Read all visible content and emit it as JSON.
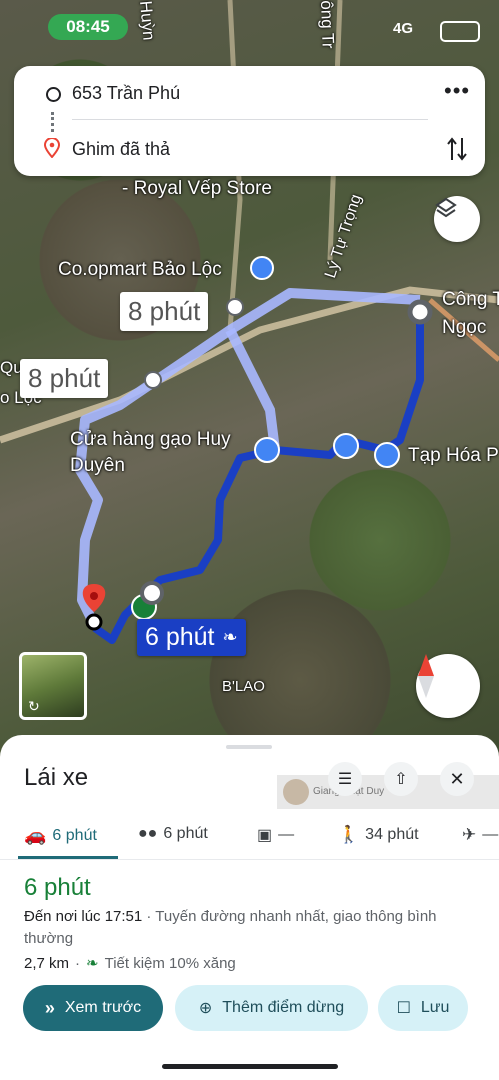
{
  "status": {
    "time": "08:45",
    "signal": "4G"
  },
  "search": {
    "origin": "653 Trần Phú",
    "destination": "Ghim đã thả"
  },
  "map": {
    "labels": {
      "royal": "- Royal Vếp Store",
      "coop": "Co.opmart Bảo Lộc",
      "ly_tu_trong": "Lý Tự Trọng",
      "cong": "Công T",
      "ngoc": "Ngọc",
      "quan": "Quán",
      "bao_loc": "o Lộc",
      "gao1": "Cửa hàng gạo Huy",
      "gao2": "Duyên",
      "tap_hoa": "Tạp Hóa P",
      "blao": "B'LAO",
      "huynh": "Huỳn",
      "dong": "ông Tr"
    },
    "alt_time_1": "8 phút",
    "alt_time_2": "8 phút",
    "main_time": "6 phút"
  },
  "sheet": {
    "title": "Lái xe",
    "watermark": "Giang Nhật Duy",
    "modes": [
      {
        "icon": "car-icon",
        "label": "6 phút",
        "active": true
      },
      {
        "icon": "motorbike-icon",
        "label": "6 phút"
      },
      {
        "icon": "transit-icon",
        "label": "—"
      },
      {
        "icon": "walk-icon",
        "label": "34 phút"
      },
      {
        "icon": "flight-icon",
        "label": "—"
      }
    ],
    "duration": "6 phút",
    "arrival": "Đến nơi lúc 17:51",
    "route_desc": " · Tuyến đường nhanh nhất, giao thông bình thường",
    "distance": "2,7 km",
    "fuel": "Tiết kiệm 10% xăng",
    "buttons": {
      "preview": "Xem trước",
      "add_stop": "Thêm điểm dừng",
      "save": "Lưu"
    }
  },
  "colors": {
    "accent": "#1a73e8",
    "green": "#188038",
    "route": "#1a3fc4",
    "teal": "#1f6b78"
  }
}
